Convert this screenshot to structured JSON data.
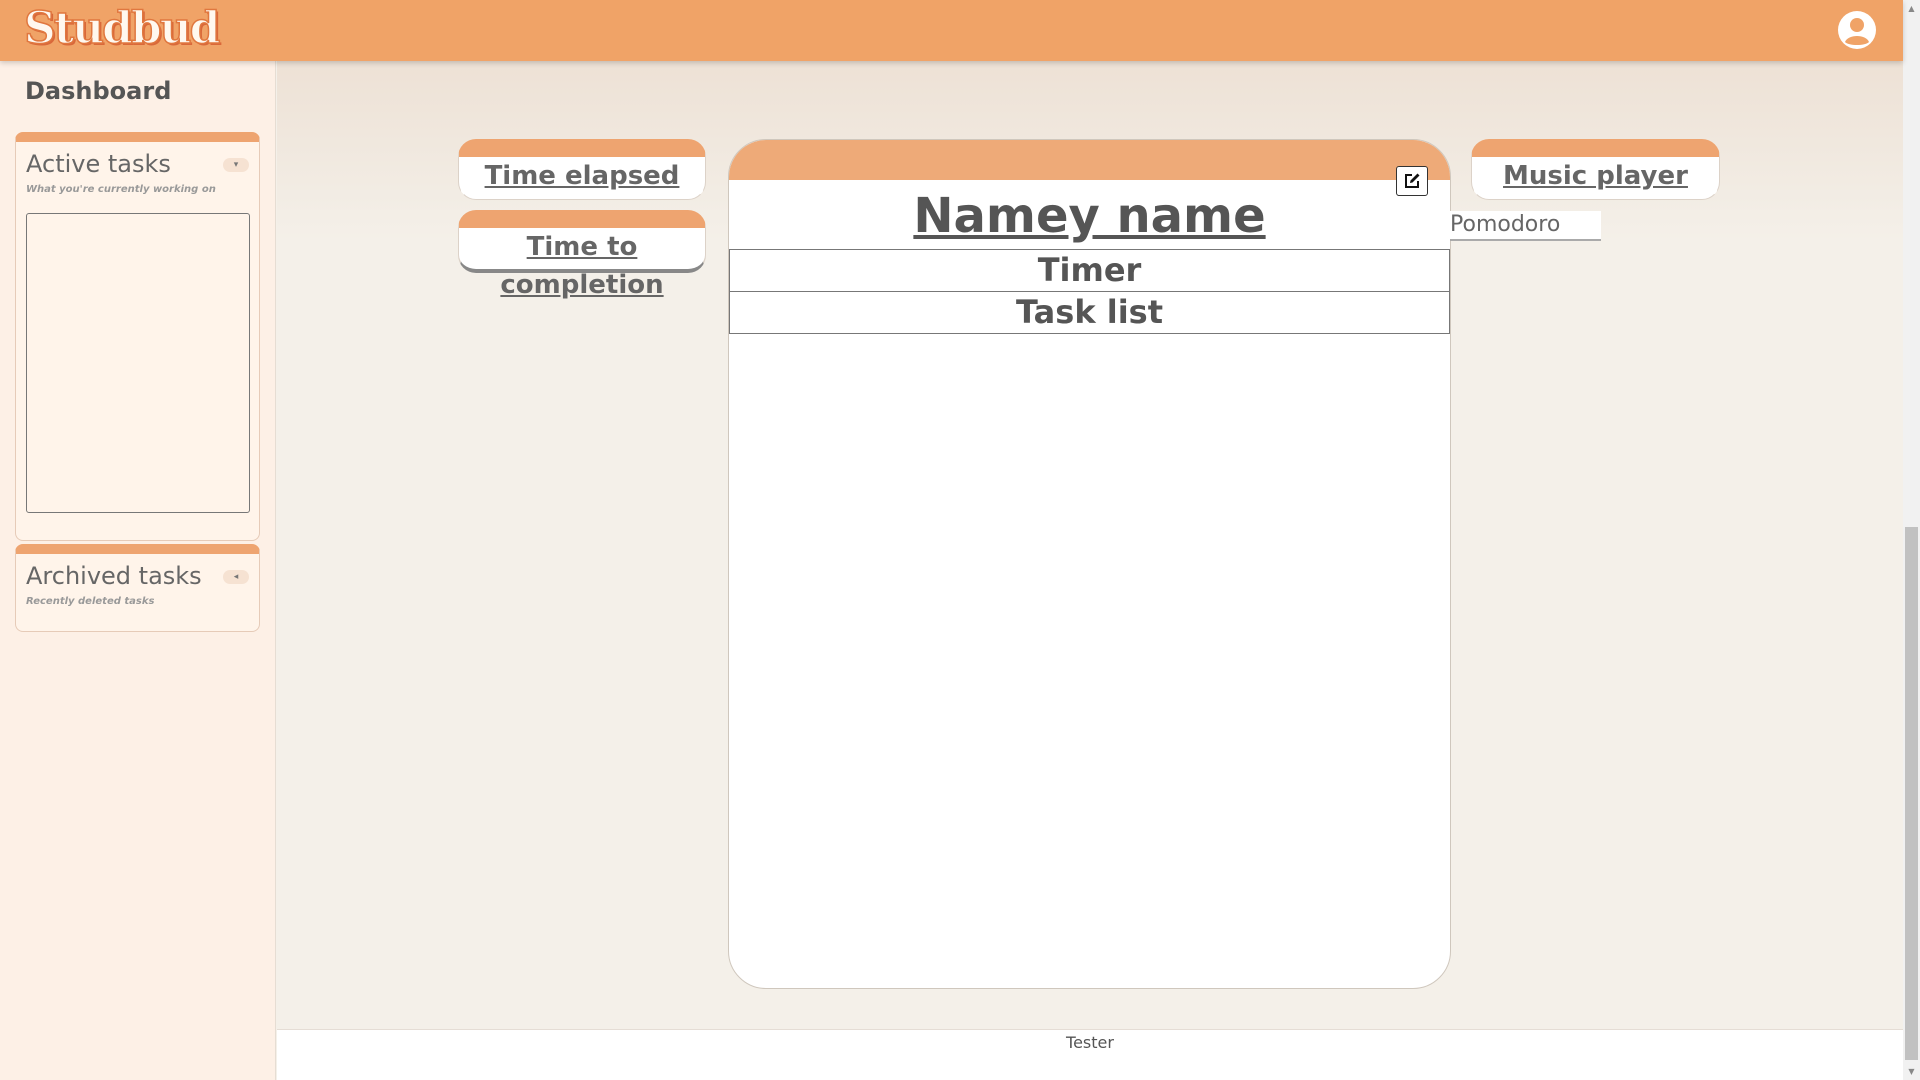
{
  "app": {
    "logo": "Studbud"
  },
  "header": {
    "account_icon": "account-circle-icon"
  },
  "sidebar": {
    "title": "Dashboard",
    "active_tasks": {
      "title": "Active tasks",
      "subtitle": "What you're currently working on",
      "toggle": "▾"
    },
    "archived_tasks": {
      "title": "Archived tasks",
      "subtitle": "Recently deleted tasks",
      "toggle": "◂"
    }
  },
  "widgets": {
    "time_elapsed": "Time elapsed",
    "time_to_completion": "Time to completion",
    "music_player": "Music player",
    "pomodoro": "Pomodoro"
  },
  "card": {
    "title": "Namey name",
    "edit_icon": "edit-icon",
    "rows": {
      "timer": "Timer",
      "task_list": "Task list"
    }
  },
  "footer": {
    "text": "Tester"
  },
  "colors": {
    "header": "#f0a367",
    "accent": "#eea470",
    "sidebar_bg": "#fdf0e6",
    "main_bg": "#f4f0e9"
  }
}
